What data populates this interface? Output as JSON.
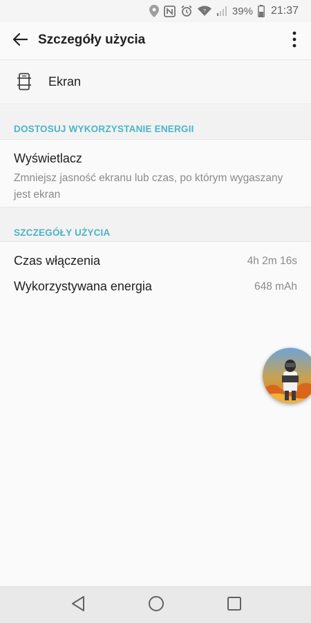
{
  "status_bar": {
    "battery_percent": "39%",
    "time": "21:37",
    "icons": [
      "location-icon",
      "nfc-icon",
      "alarm-icon",
      "wifi-icon",
      "signal-icon",
      "battery-icon"
    ]
  },
  "app_bar": {
    "title": "Szczegóły użycia",
    "back_icon": "arrow-back-icon",
    "menu_icon": "more-vert-icon"
  },
  "app": {
    "name": "Ekran",
    "icon": "screen-icon"
  },
  "sections": {
    "optimize_header": "DOSTOSUJ WYKORZYSTANIE ENERGII",
    "details_header": "SZCZEGÓŁY UŻYCIA"
  },
  "display_pref": {
    "title": "Wyświetlacz",
    "summary": "Zmniejsz jasność ekranu lub czas, po którym wygaszany jest ekran"
  },
  "details": [
    {
      "label": "Czas włączenia",
      "value": "4h 2m 16s"
    },
    {
      "label": "Wykorzystywana energia",
      "value": "648 mAh"
    }
  ],
  "nav": {
    "icons": [
      "nav-back-icon",
      "nav-home-icon",
      "nav-recents-icon"
    ]
  },
  "colors": {
    "accent": "#4bb4c7",
    "background": "#fafafa",
    "secondary_text": "#8a8a8a"
  }
}
